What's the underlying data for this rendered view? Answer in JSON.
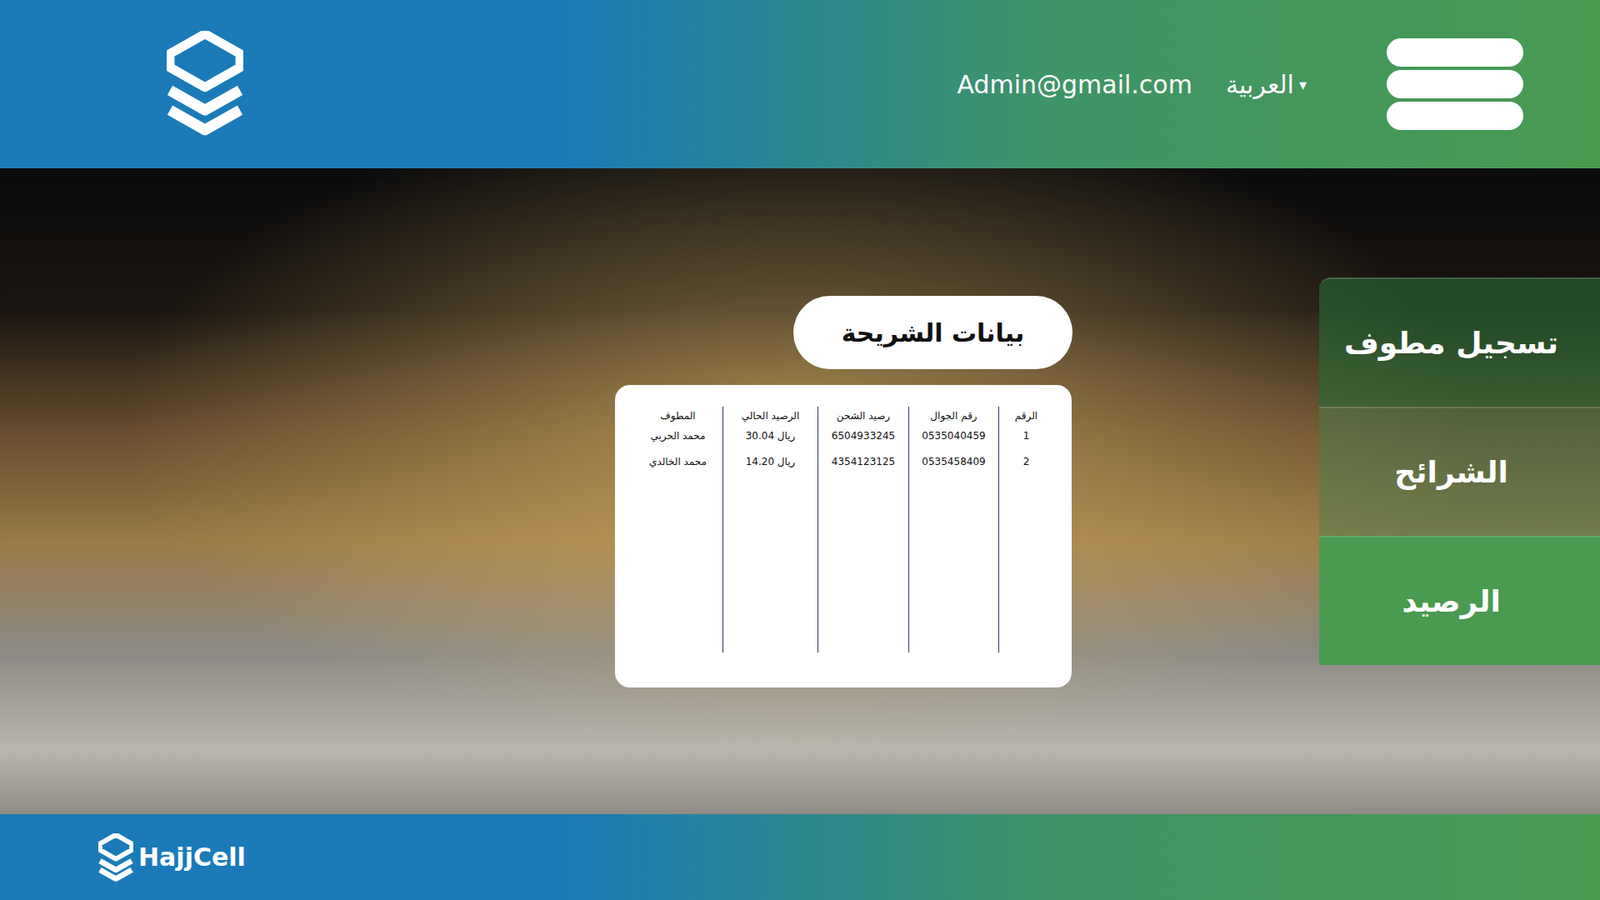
{
  "header": {
    "email": "Admin@gmail.com",
    "language": "العربية",
    "language_caret": "▾"
  },
  "brand": {
    "name": "HajjCell"
  },
  "sidebar": {
    "items": [
      {
        "label": "تسجيل مطوف",
        "selected": false
      },
      {
        "label": "الشرائح",
        "selected": false
      },
      {
        "label": "الرصيد",
        "selected": true
      }
    ]
  },
  "panel": {
    "title": "بيانات الشريحة"
  },
  "table": {
    "columns": [
      "الرقم",
      "رقم الجوال",
      "رصيد الشحن",
      "الرصيد الحالي",
      "المطوف"
    ],
    "rows": [
      [
        "1",
        "0535040459",
        "6504933245",
        "ريال 30.04",
        "محمد الحربي"
      ],
      [
        "2",
        "0535458409",
        "4354123125",
        "ريال 14.20",
        "محمد الخالدي"
      ]
    ]
  }
}
